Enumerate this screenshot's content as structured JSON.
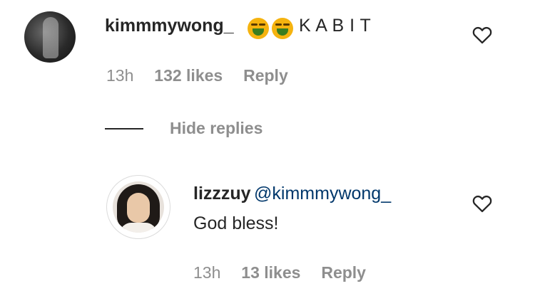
{
  "comment": {
    "username": "kimmmywong_",
    "text": "K A B I T",
    "emojis": [
      "nauseated-face",
      "nauseated-face"
    ],
    "time": "13h",
    "likes": "132 likes",
    "reply_label": "Reply"
  },
  "replies_toggle": {
    "label": "Hide replies"
  },
  "reply": {
    "username": "lizzzuy",
    "mention": "@kimmmywong_",
    "text": "God bless!",
    "time": "13h",
    "likes": "13 likes",
    "reply_label": "Reply"
  },
  "colors": {
    "text": "#262626",
    "meta": "#8e8e8e",
    "mention": "#00376b",
    "emoji": "#f5b30f"
  }
}
